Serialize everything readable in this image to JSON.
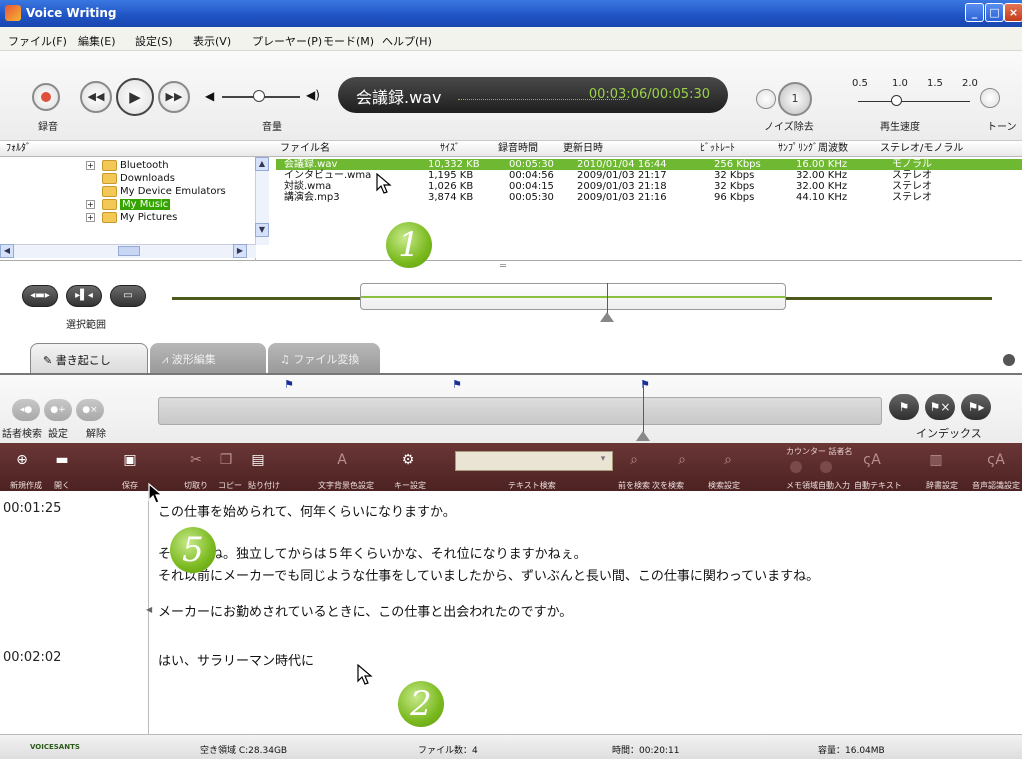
{
  "window": {
    "title": "Voice Writing",
    "buttons": [
      "_",
      "□",
      "×"
    ]
  },
  "menu": [
    "ファイル(F)",
    "編集(E)",
    "設定(S)",
    "表示(V)",
    "プレーヤー(P)",
    "モード(M)",
    "ヘルプ(H)"
  ],
  "player": {
    "record_label": "録音",
    "volume_label": "音量",
    "file_name": "会議録.wav",
    "time": "00:03:06/00:05:30",
    "noise_label": "ノイズ除去",
    "noise_level": "1",
    "speed_label": "再生速度",
    "speed_ticks": [
      "0.5",
      "1.0",
      "1.5",
      "2.0"
    ],
    "tone_label": "トーン"
  },
  "browser": {
    "folder_header": "ﾌｫﾙﾀﾞ",
    "columns": [
      "ファイル名",
      "ｻｲｽﾞ",
      "録音時間",
      "更新日時",
      "ﾋﾞｯﾄﾚｰﾄ",
      "ｻﾝﾌﾟﾘﾝｸﾞ周波数",
      "ステレオ/モノラル"
    ],
    "folders": [
      "Bluetooth",
      "Downloads",
      "My Device Emulators",
      "My Music",
      "My Pictures"
    ],
    "files": [
      {
        "name": "会議録.wav",
        "size": "10,332 KB",
        "length": "00:05:30",
        "date": "2010/01/04 16:44",
        "bitrate": "256 Kbps",
        "freq": "16.00 KHz",
        "channel": "モノラル"
      },
      {
        "name": "インタビュー.wma",
        "size": "1,195 KB",
        "length": "00:04:56",
        "date": "2009/01/03 21:17",
        "bitrate": "32 Kbps",
        "freq": "32.00 KHz",
        "channel": "ステレオ"
      },
      {
        "name": "対談.wma",
        "size": "1,026 KB",
        "length": "00:04:15",
        "date": "2009/01/03 21:18",
        "bitrate": "32 Kbps",
        "freq": "32.00 KHz",
        "channel": "ステレオ"
      },
      {
        "name": "講演会.mp3",
        "size": "3,874 KB",
        "length": "00:05:30",
        "date": "2009/01/03 21:16",
        "bitrate": "96 Kbps",
        "freq": "44.10 KHz",
        "channel": "ステレオ"
      }
    ]
  },
  "range": {
    "label": "選択範囲",
    "position": 0.58
  },
  "tabs": [
    "書き起こし",
    "波形編集",
    "ファイル変換"
  ],
  "index": {
    "left_labels": [
      "話者検索",
      "設定",
      "解除"
    ],
    "right_label": "インデックス"
  },
  "toolbar": {
    "labels": [
      "新規作成",
      "開く",
      "保存",
      "切取り",
      "コピー",
      "貼り付け",
      "文字背景色設定",
      "キー設定",
      "テキスト検索",
      "前を検索",
      "次を検索",
      "検索設定",
      "メモ領域自動入力",
      "自動テキスト",
      "辞書設定",
      "音声認識設定"
    ],
    "counter_label": "カウンター 話者名"
  },
  "editor": {
    "timestamps": [
      "00:01:25",
      "00:02:02"
    ],
    "lines": [
      "この仕事を始められて、何年くらいになりますか。",
      "そうですね。独立してからは５年くらいかな、それ位になりますかねぇ。",
      "それ以前にメーカーでも同じような仕事をしていましたから、ずいぶんと長い間、この仕事に関わっていますね。",
      "メーカーにお勤めされているときに、この仕事と出会われたのですか。",
      "はい、サラリーマン時代に"
    ]
  },
  "status": {
    "logo": "VOICESANTS",
    "free_space": "空き領域  C:28.34GB",
    "file_count": "ファイル数：4",
    "time": "時間：00:20:11",
    "capacity": "容量：16.04MB"
  },
  "markers": [
    "1",
    "2",
    "5"
  ]
}
